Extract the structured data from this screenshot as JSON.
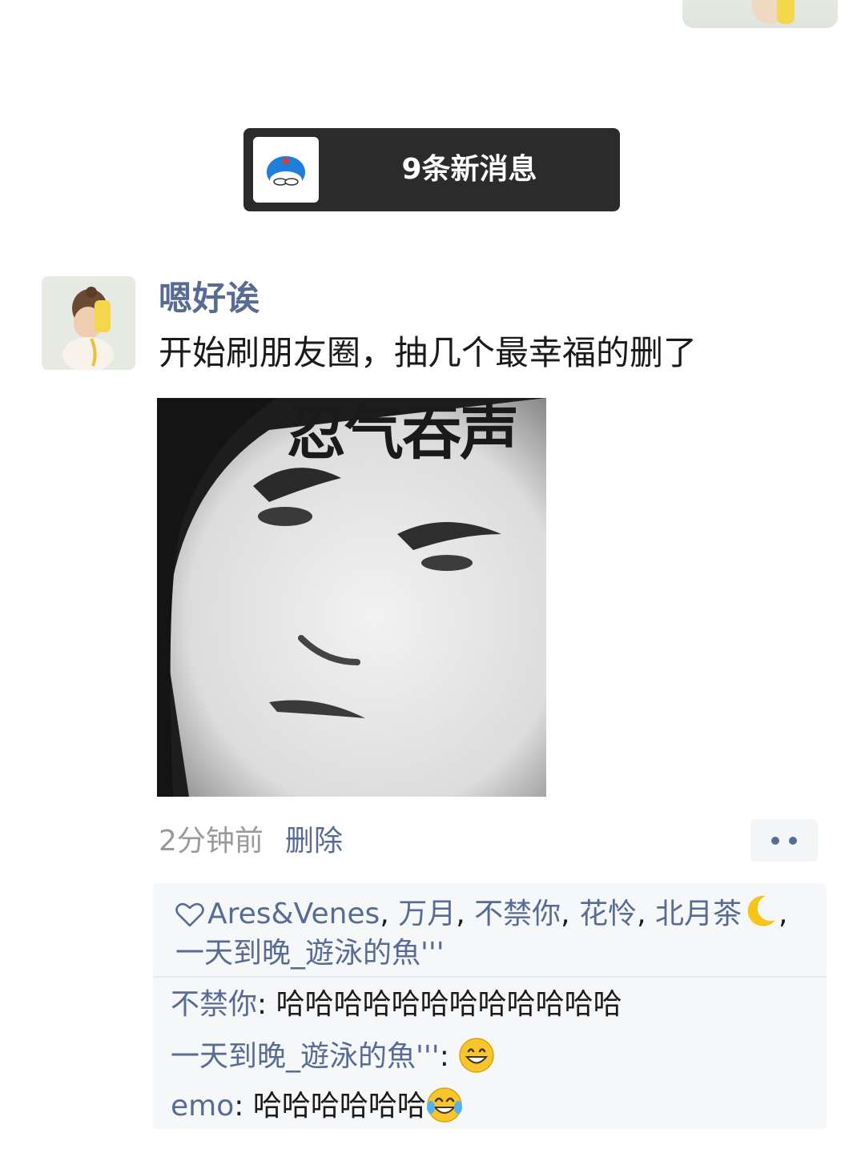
{
  "notice": {
    "text": "9条新消息",
    "avatar_icon": "doraemon-avatar-icon"
  },
  "post": {
    "author": "嗯好诶",
    "text": "开始刷朋友圈，抽几个最幸福的删了",
    "image": {
      "caption": "忍气吞声"
    },
    "time": "2分钟前",
    "delete_label": "删除",
    "more_icon": "more-dots-icon"
  },
  "likes": {
    "icon": "heart-outline-icon",
    "separator": ",",
    "users": [
      "Ares&Venes",
      "万月",
      "不禁你",
      "花怜",
      "北月茶",
      "一天到晚_遊泳的魚'''"
    ],
    "moon_icon": "crescent-moon-emoji"
  },
  "comments": [
    {
      "name": "不禁你",
      "colon": ":",
      "text": "哈哈哈哈哈哈哈哈哈哈哈哈",
      "emoji": ""
    },
    {
      "name": "一天到晚_遊泳的魚'''",
      "colon": ":",
      "text": "",
      "emoji": "grinning-face-emoji"
    },
    {
      "name": "emo",
      "colon": ":",
      "text": "哈哈哈哈哈哈",
      "emoji": "tears-of-joy-emoji"
    }
  ],
  "colors": {
    "link": "#576b95",
    "notice_bg": "#2b2b2b",
    "panel_bg": "#f6f7f9",
    "meta_gray": "#9a9a9a"
  }
}
